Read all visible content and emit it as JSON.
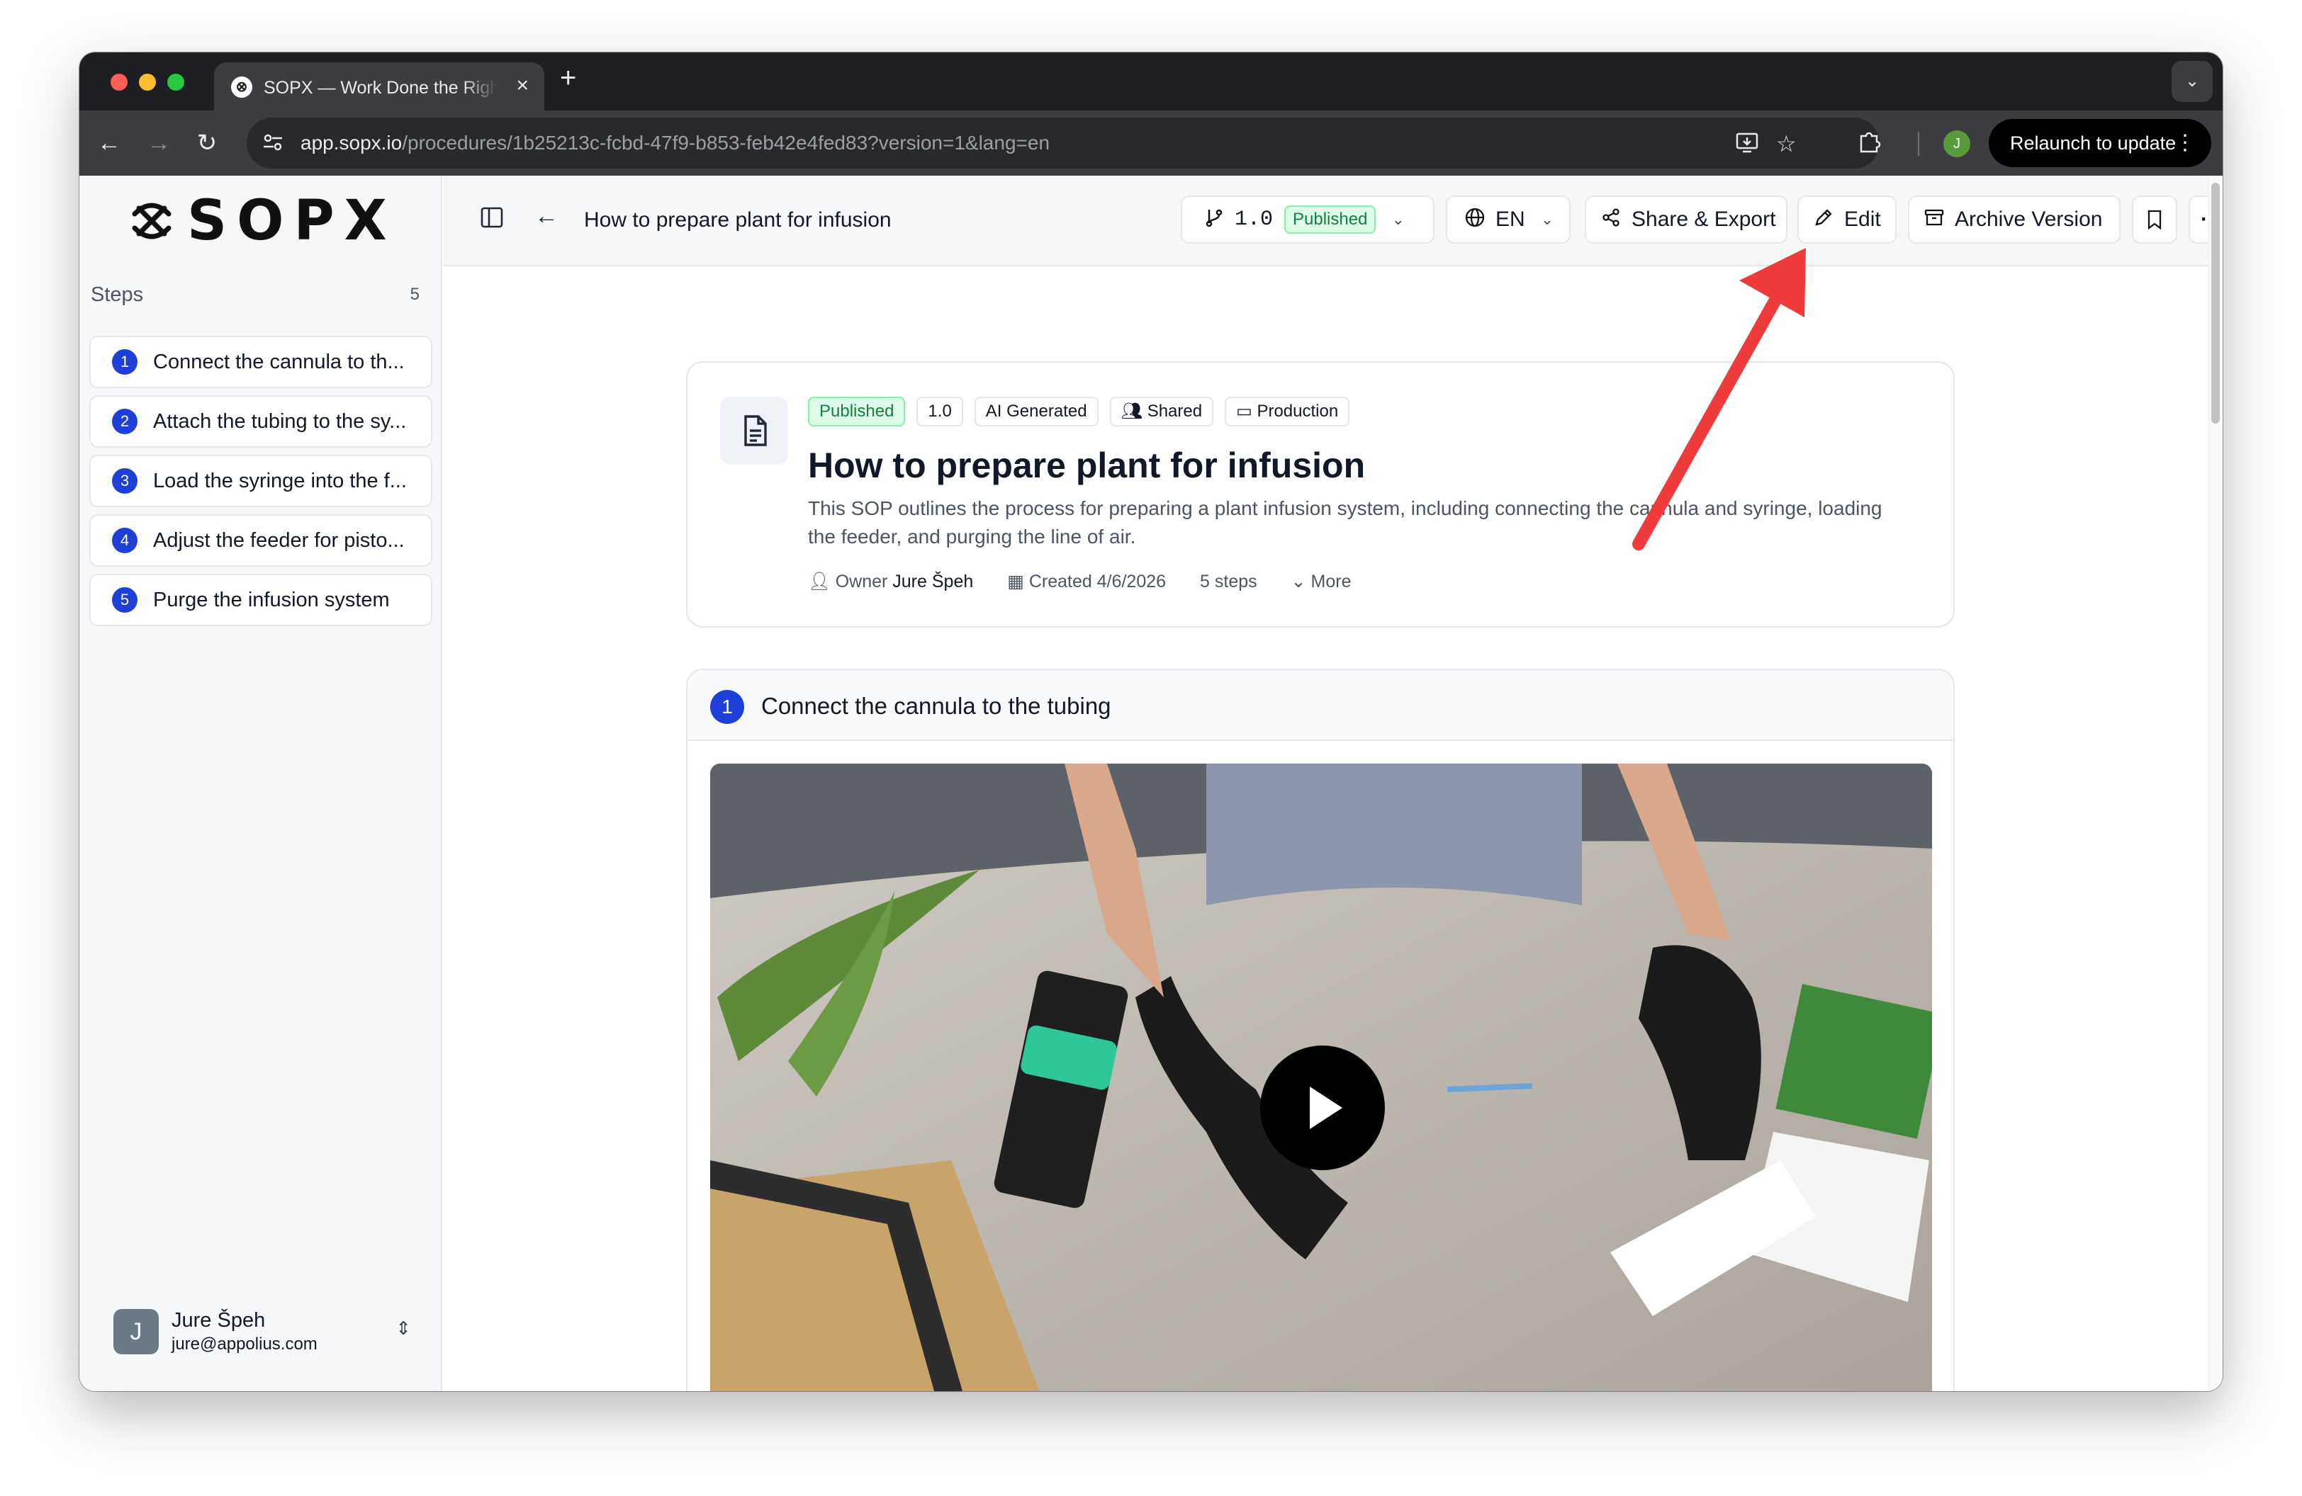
{
  "browser": {
    "tab_title": "SOPX — Work Done the Right Way",
    "url_host": "app.sopx.io",
    "url_path": "/procedures/1b25213c-fcbd-47f9-b853-feb42e4fed83?version=1&lang=en",
    "relaunch_label": "Relaunch to update",
    "profile_initial": "J"
  },
  "sidebar": {
    "logo_text": "SOPX",
    "steps_heading": "Steps",
    "steps_count": "5",
    "steps": [
      {
        "num": "1",
        "label": "Connect the cannula to th..."
      },
      {
        "num": "2",
        "label": "Attach the tubing to the sy..."
      },
      {
        "num": "3",
        "label": "Load the syringe into the f..."
      },
      {
        "num": "4",
        "label": "Adjust the feeder for pisto..."
      },
      {
        "num": "5",
        "label": "Purge the infusion system"
      }
    ],
    "user": {
      "initial": "J",
      "name": "Jure Špeh",
      "email": "jure@appolius.com"
    }
  },
  "header": {
    "title": "How to prepare plant for infusion",
    "version": "1.0",
    "version_status": "Published",
    "language": "EN",
    "share_label": "Share & Export",
    "edit_label": "Edit",
    "archive_label": "Archive Version"
  },
  "procedure": {
    "tags": [
      "Published",
      "1.0",
      "AI Generated",
      "Shared",
      "Production"
    ],
    "title": "How to prepare plant for infusion",
    "description": "This SOP outlines the process for preparing a plant infusion system, including connecting the cannula and syringe, loading the feeder, and purging the line of air.",
    "owner_label": "Owner",
    "owner_name": "Jure Špeh",
    "created": "Created 4/6/2026",
    "steps": "5 steps",
    "more": "More"
  },
  "first_step": {
    "num": "1",
    "title": "Connect the cannula to the tubing"
  },
  "colors": {
    "accent": "#1d3fd8",
    "published_bg": "#dcfce7",
    "published_text": "#15803d",
    "annotation_arrow": "#ef3b3b"
  }
}
